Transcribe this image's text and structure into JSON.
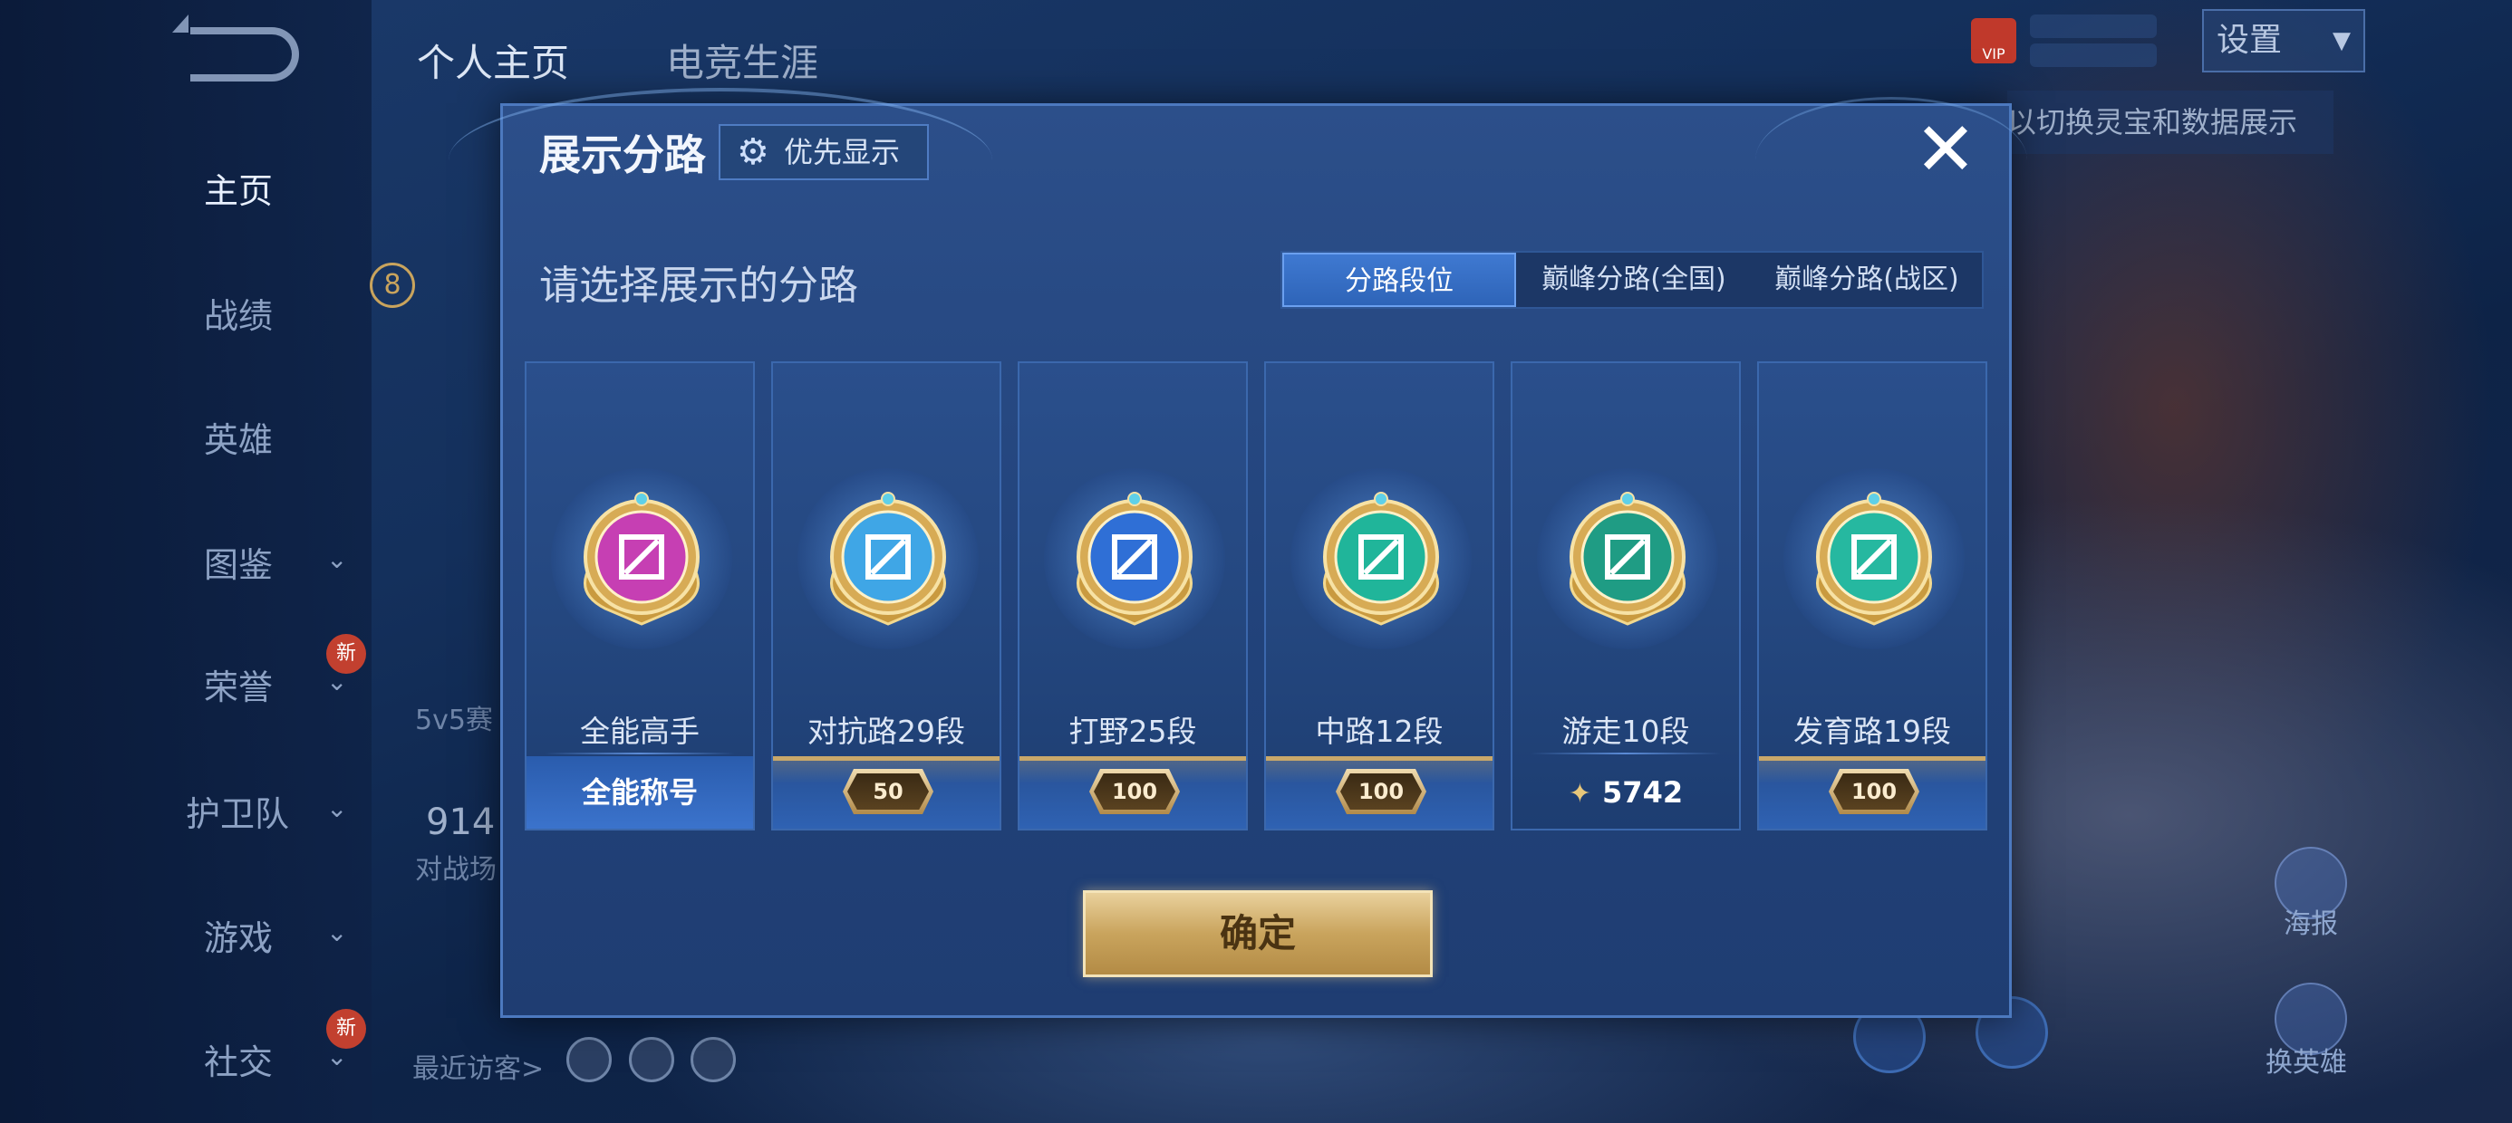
{
  "background": {
    "top_tabs": [
      "个人主页",
      "电竞生涯"
    ],
    "nav": [
      {
        "label": "主页",
        "active": true,
        "arrow": false,
        "badge": ""
      },
      {
        "label": "战绩",
        "active": false,
        "arrow": false,
        "badge": ""
      },
      {
        "label": "英雄",
        "active": false,
        "arrow": false,
        "badge": ""
      },
      {
        "label": "图鉴",
        "active": false,
        "arrow": true,
        "badge": ""
      },
      {
        "label": "荣誉",
        "active": false,
        "arrow": true,
        "badge": "新"
      },
      {
        "label": "护卫队",
        "active": false,
        "arrow": true,
        "badge": ""
      },
      {
        "label": "游戏",
        "active": false,
        "arrow": true,
        "badge": ""
      },
      {
        "label": "社交",
        "active": false,
        "arrow": true,
        "badge": "新"
      }
    ],
    "settings_label": "设置",
    "vip_label": "VIP",
    "hint_text": "以切换灵宝和数据展示",
    "level_badge": "8",
    "mode_text": "5v5赛",
    "number_text": "914",
    "battle_text": "对战场",
    "recent_visitors_label": "最近访客>",
    "poster_label": "海报",
    "switch_hero_label": "换英雄"
  },
  "dialog": {
    "title": "展示分路",
    "priority_button": "优先显示",
    "subtitle": "请选择展示的分路",
    "tabs": [
      {
        "label": "分路段位",
        "active": true
      },
      {
        "label": "巅峰分路(全国)",
        "active": false
      },
      {
        "label": "巅峰分路(战区)",
        "active": false
      }
    ],
    "cards": [
      {
        "label": "全能高手",
        "footer_type": "text",
        "footer": "全能称号",
        "badge_color": "#c63fb3",
        "icon": "all-round-icon"
      },
      {
        "label": "对抗路29段",
        "footer_type": "score",
        "footer": "50",
        "badge_color": "#3fa6e6",
        "icon": "clash-lane-icon"
      },
      {
        "label": "打野25段",
        "footer_type": "score",
        "footer": "100",
        "badge_color": "#2f6fd6",
        "icon": "jungle-icon"
      },
      {
        "label": "中路12段",
        "footer_type": "score",
        "footer": "100",
        "badge_color": "#20b59a",
        "icon": "mid-lane-icon"
      },
      {
        "label": "游走10段",
        "footer_type": "points",
        "footer": "5742",
        "badge_color": "#1f9c84",
        "icon": "roam-icon"
      },
      {
        "label": "发育路19段",
        "footer_type": "score",
        "footer": "100",
        "badge_color": "#26b8a0",
        "icon": "farm-lane-icon"
      }
    ],
    "confirm_button": "确定"
  },
  "colors": {
    "accent_blue": "#3f79d1",
    "gold": "#c9a45d",
    "dialog_bg": "#2c4f8a"
  }
}
